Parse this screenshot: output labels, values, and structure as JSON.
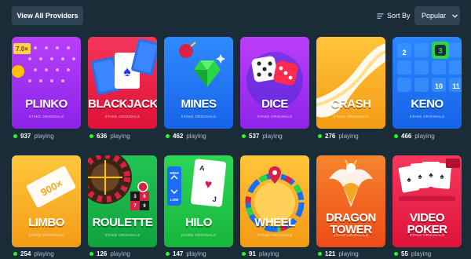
{
  "toolbar": {
    "view_all_label": "View All Providers",
    "sort_label": "Sort By",
    "sort_value": "Popular"
  },
  "games": [
    {
      "title": "PLINKO",
      "provider": "STAKE ORIGINALS",
      "count": "937",
      "suffix": "playing",
      "bg": [
        "#9b2cf0",
        "#c33af5"
      ],
      "multiplier": "7.0×"
    },
    {
      "title": "BLACKJACK",
      "provider": "STAKE ORIGINALS",
      "count": "636",
      "suffix": "playing",
      "bg": [
        "#e8183f",
        "#f5355b"
      ]
    },
    {
      "title": "MINES",
      "provider": "STAKE ORIGINALS",
      "count": "462",
      "suffix": "playing",
      "bg": [
        "#1a6ef5",
        "#2e8bff"
      ]
    },
    {
      "title": "DICE",
      "provider": "STAKE ORIGINALS",
      "count": "537",
      "suffix": "playing",
      "bg": [
        "#9b2cf0",
        "#b73cf7"
      ]
    },
    {
      "title": "CRASH",
      "provider": "STAKE ORIGINALS",
      "count": "276",
      "suffix": "playing",
      "bg": [
        "#f6a21a",
        "#ffc53a"
      ]
    },
    {
      "title": "KENO",
      "provider": "STAKE ORIGINALS",
      "count": "466",
      "suffix": "playing",
      "bg": [
        "#1a6ef5",
        "#2b86ff"
      ],
      "numbers": [
        "2",
        "3",
        "10",
        "11"
      ]
    },
    {
      "title": "LIMBO",
      "provider": "STAKE ORIGINALS",
      "count": "254",
      "suffix": "playing",
      "bg": [
        "#f6a21a",
        "#ffc53a"
      ],
      "multiplier": "900×"
    },
    {
      "title": "ROULETTE",
      "provider": "STAKE ORIGINALS",
      "count": "126",
      "suffix": "playing",
      "bg": [
        "#11a842",
        "#1fc250"
      ],
      "numbers": [
        "3",
        "6",
        "9",
        "7"
      ]
    },
    {
      "title": "HILO",
      "provider": "STAKE ORIGINALS",
      "count": "147",
      "suffix": "playing",
      "bg": [
        "#1cbf3f",
        "#2bd452"
      ],
      "labels": [
        "HIGH",
        "LOW"
      ]
    },
    {
      "title": "WHEEL",
      "provider": "STAKE ORIGINALS",
      "count": "91",
      "suffix": "playing",
      "bg": [
        "#f6a21a",
        "#ffbf35"
      ]
    },
    {
      "title": "DRAGON TOWER",
      "provider": "STAKE ORIGINALS",
      "count": "121",
      "suffix": "playing",
      "bg": [
        "#f25a1c",
        "#f57a2e"
      ]
    },
    {
      "title": "VIDEO POKER",
      "provider": "STAKE ORIGINALS",
      "count": "55",
      "suffix": "playing",
      "bg": [
        "#e8183f",
        "#f63b5f"
      ]
    }
  ]
}
